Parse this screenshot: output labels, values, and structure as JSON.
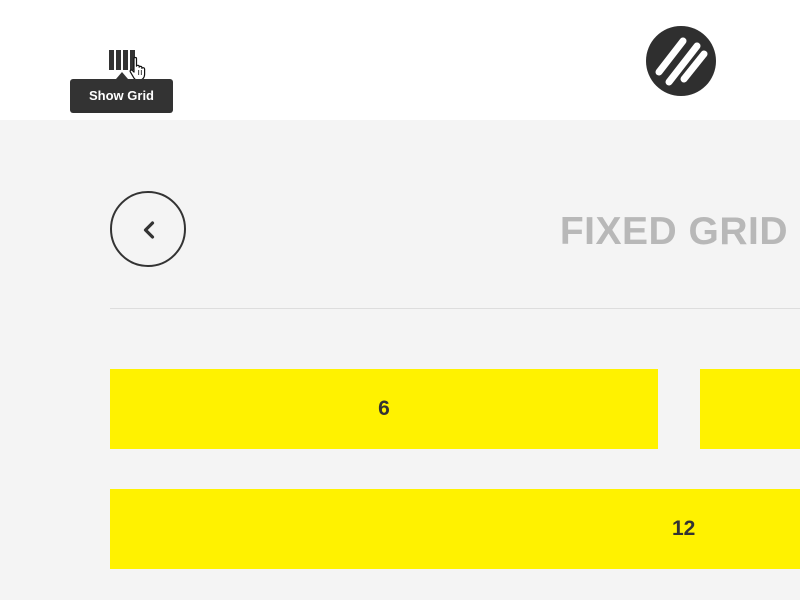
{
  "header": {
    "grid_toggle_tooltip": "Show Grid",
    "toggle_icon": "grid-columns-icon",
    "cursor_icon": "hand-pointer-icon",
    "logo_icon": "diagonal-stripes-logo-icon"
  },
  "content": {
    "title": "FIXED GRID",
    "back_icon": "chevron-left-icon",
    "rows": [
      {
        "cells": [
          {
            "label": "6"
          },
          {
            "label": ""
          }
        ]
      },
      {
        "cells": [
          {
            "label": "12"
          }
        ]
      }
    ]
  },
  "colors": {
    "header_background": "#ffffff",
    "page_background": "#f4f4f4",
    "accent_yellow": "#fff200",
    "dark": "#333333",
    "muted_title": "#b8b8b8",
    "divider": "#dddddd"
  }
}
